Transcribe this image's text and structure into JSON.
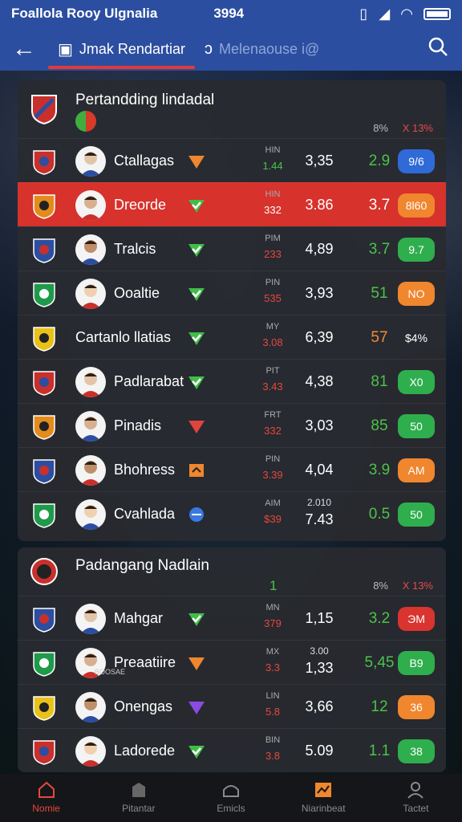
{
  "status": {
    "title": "Foallola Rooy Ulgnalia",
    "time": "3994"
  },
  "appbar": {
    "tab_active": "Jmak Rendartiar",
    "tab_inactive": "Melenaouse i@"
  },
  "league1": {
    "title": "Pertandding lindadal",
    "pct_header": "8%",
    "x_header": "X 13%",
    "rows": [
      {
        "team": "Ctallagas",
        "mark": "orange",
        "lbl": "HIN",
        "lblval": "1.44",
        "lblcolor": "green",
        "odds": "3,35",
        "score": "2.9",
        "scorecolor": "green",
        "pill": "9/6",
        "pillcolor": "blue"
      },
      {
        "team": "Dreorde",
        "mark": "green",
        "lbl": "HIN",
        "lblval": "332",
        "lblcolor": "white",
        "odds": "3.86",
        "score": "3.7",
        "scorecolor": "white",
        "pill": "8l60",
        "pillcolor": "orange"
      },
      {
        "team": "Tralcis",
        "mark": "green",
        "lbl": "PIM",
        "lblval": "233",
        "lblcolor": "red",
        "odds": "4,89",
        "score": "3.7",
        "scorecolor": "green",
        "pill": "9.7",
        "pillcolor": "green"
      },
      {
        "team": "Ooaltie",
        "mark": "green",
        "lbl": "PIN",
        "lblval": "535",
        "lblcolor": "red",
        "odds": "3,93",
        "score": "51",
        "scorecolor": "green",
        "pill": "NO",
        "pillcolor": "orange"
      },
      {
        "team": "Cartanlo llatias",
        "mark": "green",
        "lbl": "MY",
        "lblval": "3.08",
        "lblcolor": "red",
        "odds": "6,39",
        "score": "57",
        "scorecolor": "orange",
        "pill": "$4%",
        "pillcolor": "none"
      },
      {
        "team": "Padlarabat",
        "mark": "green",
        "lbl": "PIT",
        "lblval": "3.43",
        "lblcolor": "red",
        "odds": "4,38",
        "score": "81",
        "scorecolor": "green",
        "pill": "X0",
        "pillcolor": "green"
      },
      {
        "team": "Pinadis",
        "mark": "red",
        "lbl": "FRT",
        "lblval": "332",
        "lblcolor": "red",
        "odds": "3,03",
        "score": "85",
        "scorecolor": "green",
        "pill": "50",
        "pillcolor": "green"
      },
      {
        "team": "Bhohress",
        "mark": "box",
        "lbl": "PIN",
        "lblval": "3.39",
        "lblcolor": "red",
        "odds": "4,04",
        "score": "3.9",
        "scorecolor": "green",
        "pill": "AM",
        "pillcolor": "orange"
      },
      {
        "team": "Cvahlada",
        "mark": "blue",
        "lbl": "AIM",
        "lblval": "$39",
        "lblcolor": "red",
        "odds_top": "2.010",
        "odds": "7.43",
        "score": "0.5",
        "scorecolor": "green",
        "pill": "50",
        "pillcolor": "green"
      }
    ]
  },
  "league2": {
    "title": "Padangang Nadlain",
    "marker": "1",
    "pct_header": "8%",
    "x_header": "X 13%",
    "rows": [
      {
        "team": "Mahgar",
        "mark": "green",
        "lbl": "MN",
        "lblval": "379",
        "lblcolor": "red",
        "odds": "1,15",
        "score": "3.2",
        "scorecolor": "green",
        "pill": "ЭM",
        "pillcolor": "red"
      },
      {
        "team": "Preaatiire",
        "sub": "BOOSAE",
        "mark": "orange",
        "lbl": "MX",
        "lblval": "3.3",
        "lblcolor": "red",
        "odds_top": "3.00",
        "odds": "1,33",
        "score": "5,45",
        "scorecolor": "green",
        "pill": "B9",
        "pillcolor": "green"
      },
      {
        "team": "Onengas",
        "mark": "purple",
        "lbl": "LIN",
        "lblval": "5.8",
        "lblcolor": "red",
        "odds": "3,66",
        "score": "12",
        "scorecolor": "green",
        "pill": "36",
        "pillcolor": "orange"
      },
      {
        "team": "Ladorede",
        "mark": "green",
        "lbl": "BIN",
        "lblval": "3.8",
        "lblcolor": "red",
        "odds": "5.09",
        "score": "1.1",
        "scorecolor": "green",
        "pill": "38",
        "pillcolor": "green"
      }
    ]
  },
  "nav": [
    {
      "label": "Nomie",
      "icon": "home-icon"
    },
    {
      "label": "Pitantar",
      "icon": "building-icon"
    },
    {
      "label": "Emicls",
      "icon": "stadium-icon"
    },
    {
      "label": "Niarinbeat",
      "icon": "chart-icon"
    },
    {
      "label": "Tactet",
      "icon": "profile-icon"
    }
  ]
}
